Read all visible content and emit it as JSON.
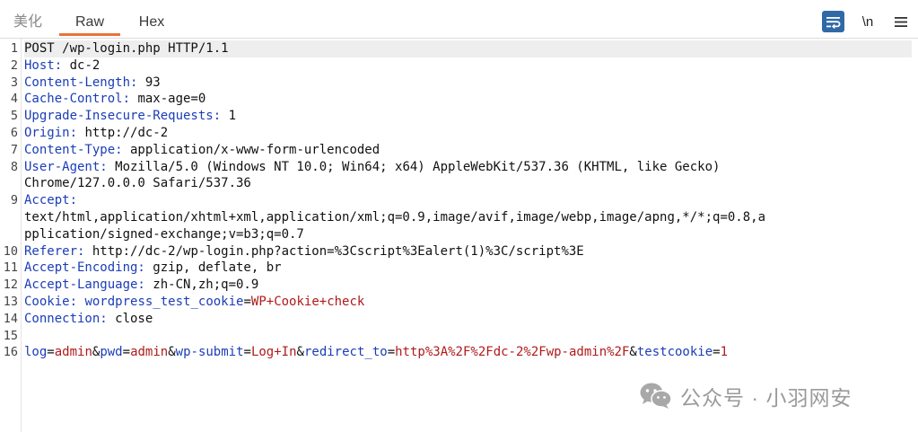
{
  "tabs": [
    {
      "label": "美化",
      "state": "inactive"
    },
    {
      "label": "Raw",
      "state": "active"
    },
    {
      "label": "Hex",
      "state": "inactive"
    }
  ],
  "toolbar": {
    "wrap_icon": "word-wrap-icon",
    "newline_label": "\\n",
    "menu_icon": "hamburger-menu-icon"
  },
  "colors": {
    "accent_tab": "#e8733a",
    "header_key": "#1b3db8",
    "param_value": "#b01a1a",
    "wrap_button": "#2f6aa7"
  },
  "request": {
    "lines": [
      {
        "num": "1",
        "text": "POST /wp-login.php HTTP/1.1"
      },
      {
        "num": "2",
        "key": "Host",
        "value": " dc-2"
      },
      {
        "num": "3",
        "key": "Content-Length",
        "value": " 93"
      },
      {
        "num": "4",
        "key": "Cache-Control",
        "value": " max-age=0"
      },
      {
        "num": "5",
        "key": "Upgrade-Insecure-Requests",
        "value": " 1"
      },
      {
        "num": "6",
        "key": "Origin",
        "value": " http://dc-2"
      },
      {
        "num": "7",
        "key": "Content-Type",
        "value": " application/x-www-form-urlencoded"
      },
      {
        "num": "8",
        "key": "User-Agent",
        "value": " Mozilla/5.0 (Windows NT 10.0; Win64; x64) AppleWebKit/537.36 (KHTML, like Gecko)"
      },
      {
        "num": "",
        "cont": "Chrome/127.0.0.0 Safari/537.36"
      },
      {
        "num": "9",
        "key": "Accept",
        "value": ""
      },
      {
        "num": "",
        "cont": "text/html,application/xhtml+xml,application/xml;q=0.9,image/avif,image/webp,image/apng,*/*;q=0.8,a"
      },
      {
        "num": "",
        "cont": "pplication/signed-exchange;v=b3;q=0.7"
      },
      {
        "num": "10",
        "key": "Referer",
        "value": " http://dc-2/wp-login.php?action=%3Cscript%3Ealert(1)%3C/script%3E"
      },
      {
        "num": "11",
        "key": "Accept-Encoding",
        "value": " gzip, deflate, br"
      },
      {
        "num": "12",
        "key": "Accept-Language",
        "value": " zh-CN,zh;q=0.9"
      },
      {
        "num": "13",
        "cookie": {
          "key": "Cookie",
          "name": "wordpress_test_cookie",
          "val": "WP+Cookie+check"
        }
      },
      {
        "num": "14",
        "key": "Connection",
        "value": " close"
      },
      {
        "num": "15",
        "empty": true
      },
      {
        "num": "16",
        "params": [
          {
            "k": "log",
            "v": "admin"
          },
          {
            "k": "pwd",
            "v": "admin"
          },
          {
            "k": "wp-submit",
            "v": "Log+In"
          },
          {
            "k": "redirect_to",
            "v": "http%3A%2F%2Fdc-2%2Fwp-admin%2F"
          },
          {
            "k": "testcookie",
            "v": "1"
          }
        ]
      }
    ]
  },
  "watermark": {
    "icon": "wechat-icon",
    "text": "公众号 · 小羽网安"
  }
}
